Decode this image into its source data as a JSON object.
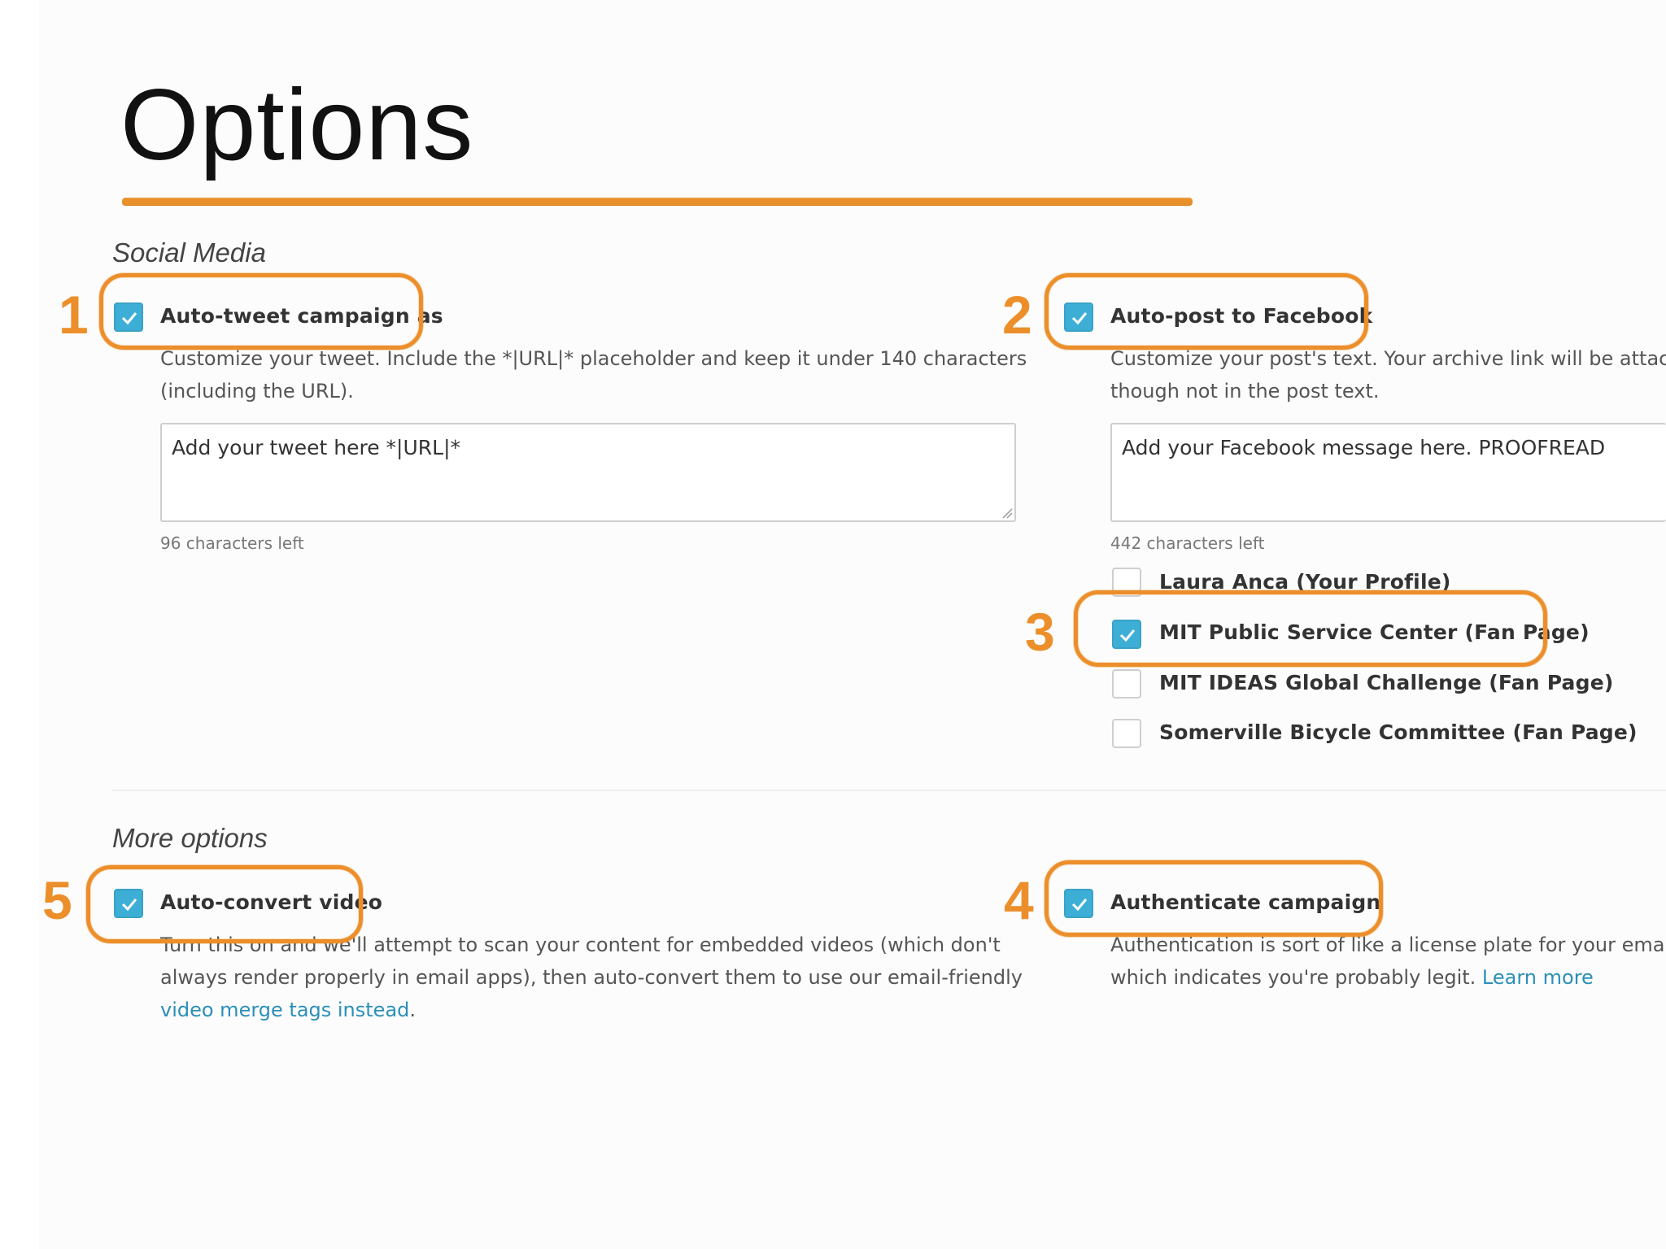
{
  "slide": {
    "title": "Options"
  },
  "social_media": {
    "heading": "Social Media",
    "twitter": {
      "label": "Auto-tweet campaign as",
      "checked": true,
      "description_line1": "Customize your tweet. Include the *|URL|* placeholder and keep it under 140 characters",
      "description_line2": "(including the URL).",
      "textarea_value": "Add your tweet here *|URL|*",
      "chars_left": "96 characters left"
    },
    "facebook": {
      "label": "Auto-post to Facebook",
      "checked": true,
      "description_line1": "Customize your post's text. Your archive link will be attached",
      "description_line2": "though not in the post text.",
      "textarea_value": "Add your Facebook message here. PROOFREAD",
      "chars_left": "442 characters left",
      "pages": [
        {
          "label": "Laura Anca (Your Profile)",
          "checked": false
        },
        {
          "label": "MIT Public Service Center (Fan Page)",
          "checked": true
        },
        {
          "label": "MIT IDEAS Global Challenge (Fan Page)",
          "checked": false
        },
        {
          "label": "Somerville Bicycle Committee (Fan Page)",
          "checked": false
        }
      ]
    }
  },
  "more_options": {
    "heading": "More options",
    "video": {
      "label": "Auto-convert video",
      "checked": true,
      "description_line1": "Turn this on and we'll attempt to scan your content for embedded videos (which don't",
      "description_line2": "always render properly in email apps), then auto-convert them to use our email-friendly",
      "link": "video merge tags instead",
      "description_end": "."
    },
    "authenticate": {
      "label": "Authenticate campaign",
      "checked": true,
      "description_line1": "Authentication is sort of like a license plate for your email. It",
      "description_line2": "which indicates you're probably legit.",
      "link": "Learn more"
    }
  },
  "callouts": [
    "1",
    "2",
    "3",
    "4",
    "5"
  ],
  "colors": {
    "accent": "#ec8f2b",
    "checkbox": "#3dafd6",
    "link": "#2b8fb8"
  }
}
